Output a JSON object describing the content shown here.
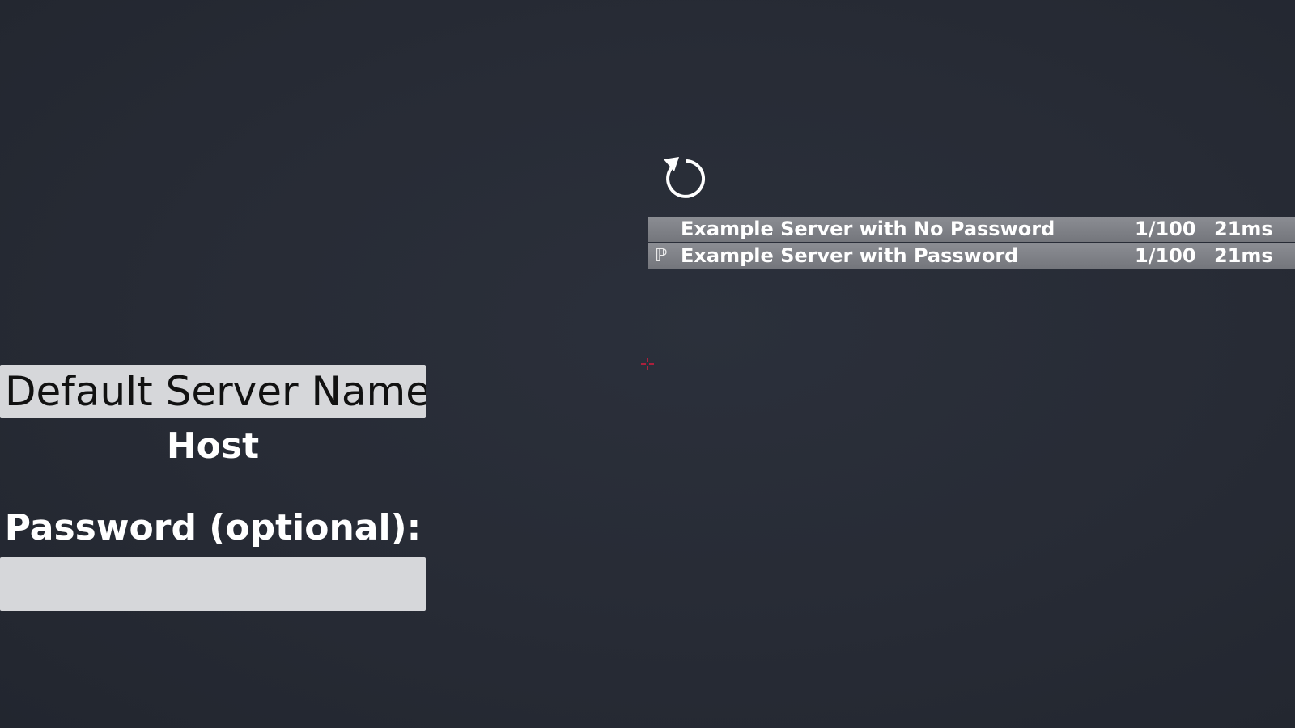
{
  "host_panel": {
    "server_name_value": "Default Server Name",
    "host_label": "Host",
    "password_label": "Password (optional):",
    "password_value": ""
  },
  "server_browser": {
    "refresh_icon": "refresh-icon",
    "servers": [
      {
        "locked": false,
        "lock_glyph": "",
        "name": "Example Server with No Password",
        "players": "1/100",
        "ping": "21ms"
      },
      {
        "locked": true,
        "lock_glyph": "ℙ",
        "name": "Example Server with Password",
        "players": "1/100",
        "ping": "21ms"
      }
    ]
  },
  "colors": {
    "background": "#272b35",
    "field_fill": "#d6d7da",
    "row_fill": "#7f8187",
    "crosshair": "#d81b3c",
    "text": "#ffffff"
  },
  "crosshair_icon": "crosshair-icon"
}
